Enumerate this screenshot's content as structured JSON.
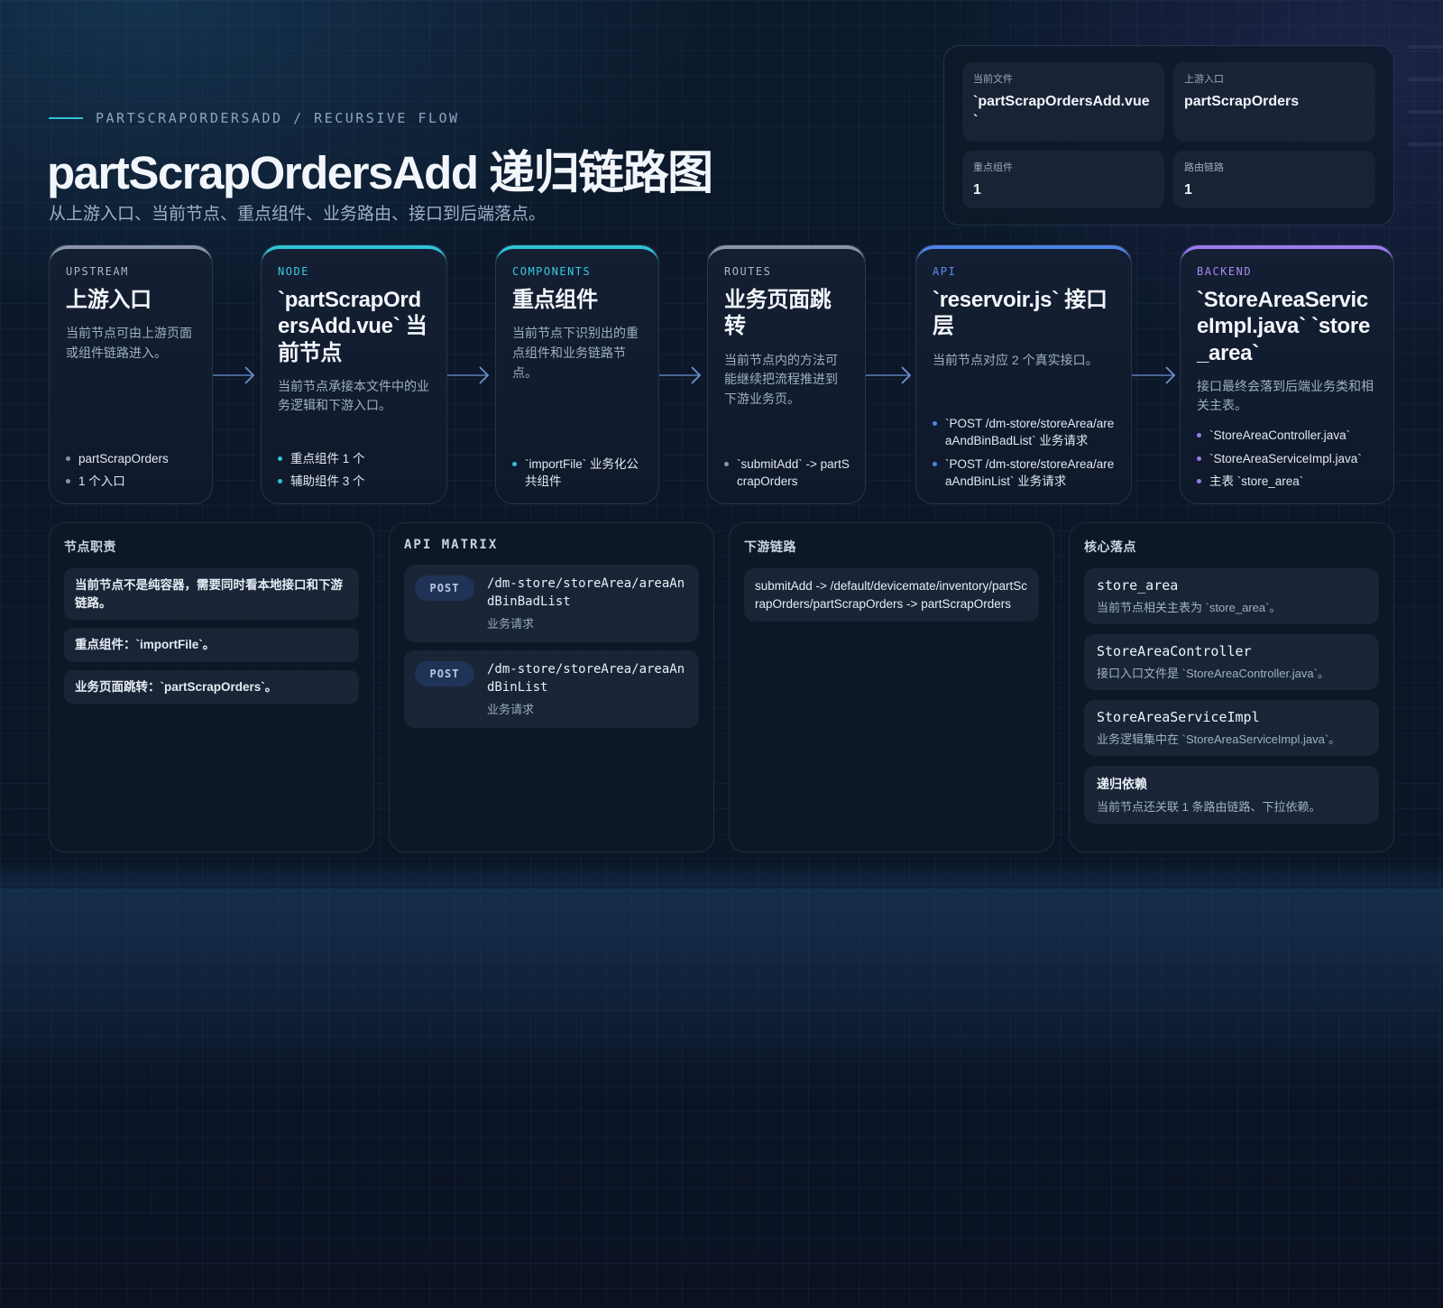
{
  "header": {
    "eyebrow": "PARTSCRAPORDERSADD / RECURSIVE FLOW",
    "title": "partScrapOrdersAdd 递归链路图",
    "subtitle": "从上游入口、当前节点、重点组件、业务路由、接口到后端落点。"
  },
  "stats": [
    {
      "label": "当前文件",
      "value": "`partScrapOrdersAdd.vue`"
    },
    {
      "label": "上游入口",
      "value": "partScrapOrders"
    },
    {
      "label": "重点组件",
      "value": "1"
    },
    {
      "label": "路由链路",
      "value": "1"
    }
  ],
  "flow": [
    {
      "tag": "UPSTREAM",
      "title": "上游入口",
      "desc": "当前节点可由上游页面或组件链路进入。",
      "items": [
        "partScrapOrders",
        "1 个入口"
      ],
      "accent": "#8a95a8",
      "tagColor": "#aab6c8",
      "dot": "#8a95a8"
    },
    {
      "tag": "NODE",
      "title": "`partScrapOrdersAdd.vue` 当前节点",
      "desc": "当前节点承接本文件中的业务逻辑和下游入口。",
      "items": [
        "重点组件 1 个",
        "辅助组件 3 个"
      ],
      "accent": "#2ec4d6",
      "tagColor": "#37cbe0",
      "dot": "#2ec4d6"
    },
    {
      "tag": "COMPONENTS",
      "title": "重点组件",
      "desc": "当前节点下识别出的重点组件和业务链路节点。",
      "items": [
        "`importFile` 业务化公共组件"
      ],
      "accent": "#2ec4d6",
      "tagColor": "#37cbe0",
      "dot": "#2ec4d6"
    },
    {
      "tag": "ROUTES",
      "title": "业务页面跳转",
      "desc": "当前节点内的方法可能继续把流程推进到下游业务页。",
      "items": [
        "`submitAdd` -> partScrapOrders"
      ],
      "accent": "#8a95a8",
      "tagColor": "#aab6c8",
      "dot": "#8a95a8"
    },
    {
      "tag": "API",
      "title": "`reservoir.js` 接口层",
      "desc": "当前节点对应 2 个真实接口。",
      "items": [
        "`POST /dm-store/storeArea/areaAndBinBadList` 业务请求",
        "`POST /dm-store/storeArea/areaAndBinList` 业务请求"
      ],
      "accent": "#4d84e8",
      "tagColor": "#5b8ff0",
      "dot": "#4d84e8"
    },
    {
      "tag": "BACKEND",
      "title": "`StoreAreaServiceImpl.java` `store_area`",
      "desc": "接口最终会落到后端业务类和相关主表。",
      "items": [
        "`StoreAreaController.java`",
        "`StoreAreaServiceImpl.java`",
        "主表 `store_area`"
      ],
      "accent": "#9b7cf0",
      "tagColor": "#a58cf2",
      "dot": "#9b7cf0"
    }
  ],
  "responsibility": {
    "title": "节点职责",
    "items": [
      "当前节点不是纯容器，需要同时看本地接口和下游链路。",
      "重点组件：`importFile`。",
      "业务页面跳转：`partScrapOrders`。"
    ]
  },
  "api_matrix": {
    "title": "API MATRIX",
    "items": [
      {
        "method": "POST",
        "path": "/dm-store/storeArea/areaAndBinBadList",
        "desc": "业务请求"
      },
      {
        "method": "POST",
        "path": "/dm-store/storeArea/areaAndBinList",
        "desc": "业务请求"
      }
    ]
  },
  "downstream": {
    "title": "下游链路",
    "items": [
      "submitAdd -> /default/devicemate/inventory/partScrapOrders/partScrapOrders -> partScrapOrders"
    ]
  },
  "core": {
    "title": "核心落点",
    "items": [
      {
        "title": "store_area",
        "desc": "当前节点相关主表为 `store_area`。"
      },
      {
        "title": "StoreAreaController",
        "desc": "接口入口文件是 `StoreAreaController.java`。"
      },
      {
        "title": "StoreAreaServiceImpl",
        "desc": "业务逻辑集中在 `StoreAreaServiceImpl.java`。"
      },
      {
        "title": "递归依赖",
        "desc": "当前节点还关联 1 条路由链路、下拉依赖。"
      }
    ]
  }
}
